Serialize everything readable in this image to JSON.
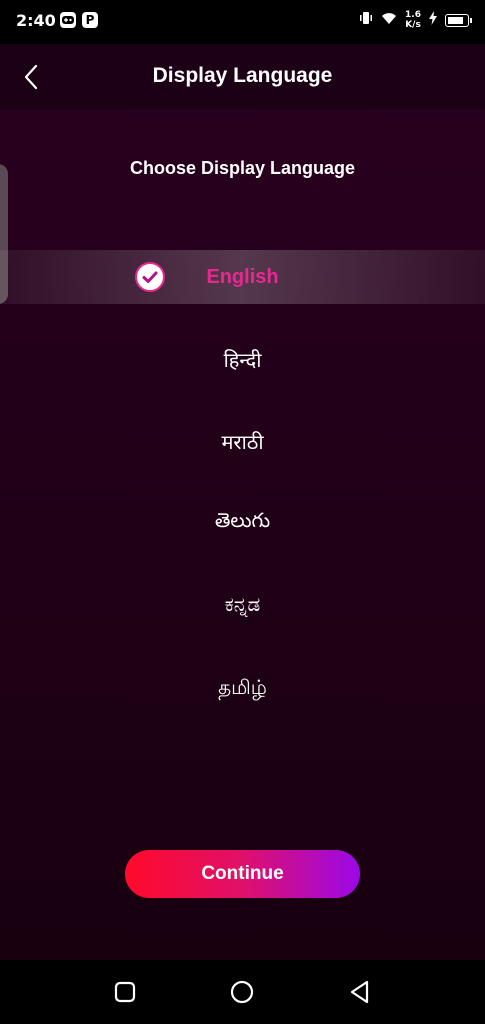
{
  "status_bar": {
    "time": "2:40",
    "app_icons": [
      "gamepad-icon",
      "p-app-icon"
    ],
    "net_speed_value": "1.6",
    "net_speed_unit": "K/s",
    "icons": [
      "vibrate-icon",
      "wifi-icon",
      "charging-icon",
      "battery-icon"
    ]
  },
  "header": {
    "title": "Display Language",
    "back_icon": "chevron-left-icon"
  },
  "subtitle": "Choose Display Language",
  "languages": [
    {
      "label": "English",
      "selected": true
    },
    {
      "label": "हिन्दी",
      "selected": false
    },
    {
      "label": "मराठी",
      "selected": false
    },
    {
      "label": "తెలుగు",
      "selected": false
    },
    {
      "label": "ಕನ್ನಡ",
      "selected": false
    },
    {
      "label": "தமிழ்",
      "selected": false
    }
  ],
  "continue_button": {
    "label": "Continue"
  },
  "colors": {
    "accent_pink": "#e8288f",
    "button_gradient_start": "#ff0a2a",
    "button_gradient_end": "#9b08e8",
    "background": "#220019"
  },
  "nav_bar": {
    "icons": [
      "square-recents-icon",
      "circle-home-icon",
      "triangle-back-icon"
    ]
  }
}
